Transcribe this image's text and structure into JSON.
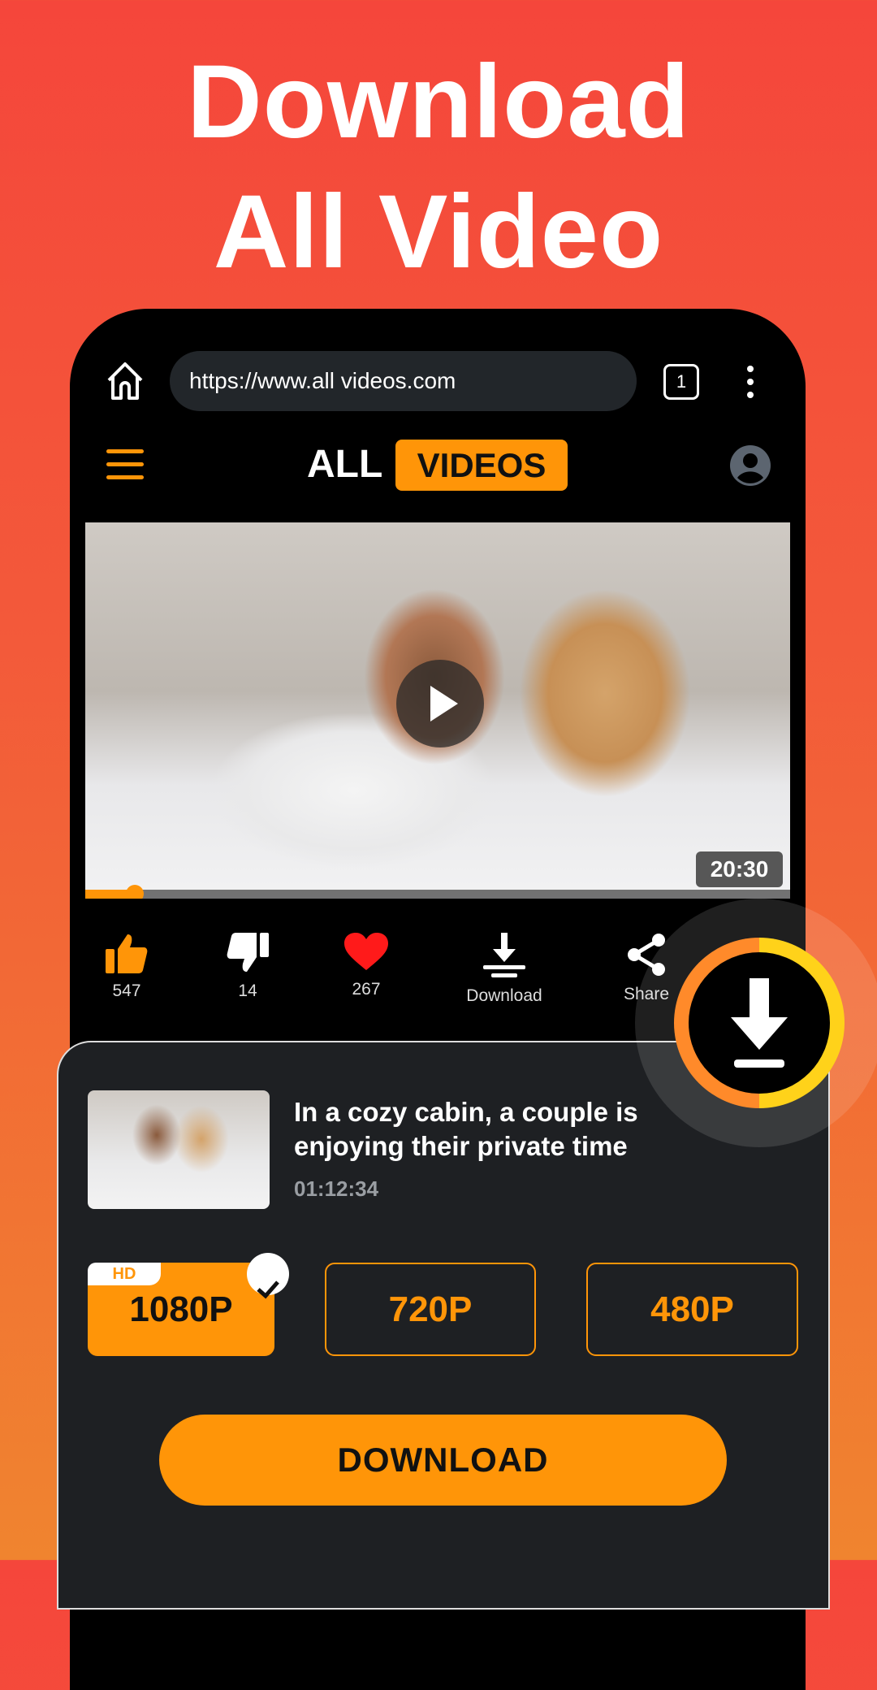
{
  "headline": {
    "line1": "Download",
    "line2": "All Video"
  },
  "browser": {
    "url": "https://www.all videos.com",
    "tab_count": "1"
  },
  "site": {
    "logo_left": "ALL",
    "logo_right": "VIDEOS"
  },
  "video": {
    "duration": "20:30",
    "progress_percent": 7
  },
  "actions": [
    {
      "icon": "thumbs-up-icon",
      "label": "547"
    },
    {
      "icon": "thumbs-down-icon",
      "label": "14"
    },
    {
      "icon": "heart-icon",
      "label": "267"
    },
    {
      "icon": "download-icon",
      "label": "Download"
    },
    {
      "icon": "share-icon",
      "label": "Share"
    }
  ],
  "sheet": {
    "title": "In a cozy cabin, a couple is enjoying their private time",
    "duration": "01:12:34",
    "hd_badge": "HD",
    "qualities": [
      "1080P",
      "720P",
      "480P"
    ],
    "selected": "1080P",
    "download_label": "DOWNLOAD"
  },
  "colors": {
    "accent": "#ff9508",
    "sheet_bg": "#1e2023",
    "heart": "#ff1a1a"
  }
}
